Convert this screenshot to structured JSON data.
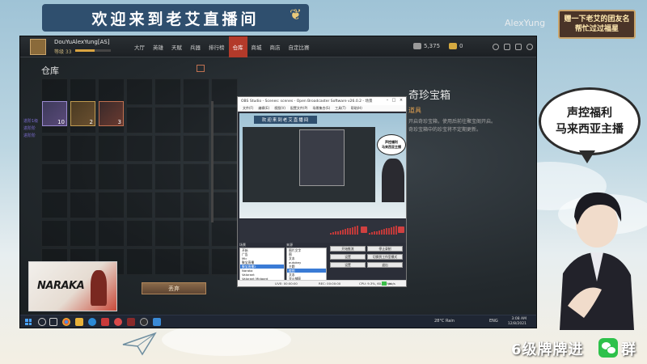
{
  "overlay": {
    "title": "欢迎来到老艾直播间",
    "streamer_name": "AlexYung",
    "gift_text": [
      "赠一下老艾的团友名",
      "帮忙过过福星"
    ],
    "bubble_lines": [
      "声控福利",
      "马来西亚主播"
    ],
    "footer_text": "6级牌牌进",
    "footer_group": "群",
    "brand_color": "#2f4f6e"
  },
  "game": {
    "player_name": "DouYuAlexYung[AS]",
    "player_level": "等级 33",
    "level_progress": 0.55,
    "nav": [
      "大厅",
      "英雄",
      "天赋",
      "兵器",
      "排行榜",
      "仓库",
      "商城",
      "商店",
      "自定比赛"
    ],
    "active_nav": "仓库",
    "currency_a": "5,375",
    "currency_b": "0",
    "warehouse_title": "仓库",
    "items": [
      {
        "count": "10",
        "tag": "进阶1级"
      },
      {
        "count": "2",
        "tag": "进阶阶"
      },
      {
        "count": "3",
        "tag": "进阶阶"
      }
    ],
    "discard_label": "丢弃",
    "treasure_title": "奇珍宝箱",
    "treasure_sub": "道具",
    "treasure_lines": [
      "开启奇珍宝箱，使用后前往聚宝阁开启。",
      "奇珍宝箱中的珍宝将不定期更新。"
    ]
  },
  "naraka": {
    "logo": "NARAKA"
  },
  "obs": {
    "title": "OBS Studio - Scenes: scenes - Open Broadcaster Software v26.0.2 - 场景",
    "menus": [
      "文件(F)",
      "编辑(E)",
      "视图(V)",
      "配置文件(P)",
      "场景集合(S)",
      "工具(T)",
      "帮助(H)"
    ],
    "preview_title": "欢迎来到老艾直播间",
    "preview_bubble": [
      "声控福利",
      "马来西亚主播"
    ],
    "scenes_head": "场景",
    "scenes": [
      "开始",
      "广告",
      "Mic",
      "聚宝直播",
      "聚宝直播2",
      "Naraka",
      "Valorant",
      "Valorant Midgard"
    ],
    "sources_head": "来源",
    "sources": [
      "图片文字",
      "图",
      "文本",
      "autokey",
      "主题",
      "截图",
      "文本",
      "显示捕获"
    ],
    "controls": [
      "开始推流",
      "停止录制",
      "设置",
      "切换到工作室模式",
      "设置",
      "退出"
    ],
    "status_live": "LIVE: 00:00:00",
    "status_rec": "REC: 00:00:00",
    "status_cpu": "CPU: 9.3%, 60.00 fps",
    "status_kbps": "kb/s"
  },
  "taskbar": {
    "weather": "28°C Rain",
    "clock_time": "3:08 AM",
    "clock_date": "12/8/2021",
    "lang": "ENG"
  }
}
